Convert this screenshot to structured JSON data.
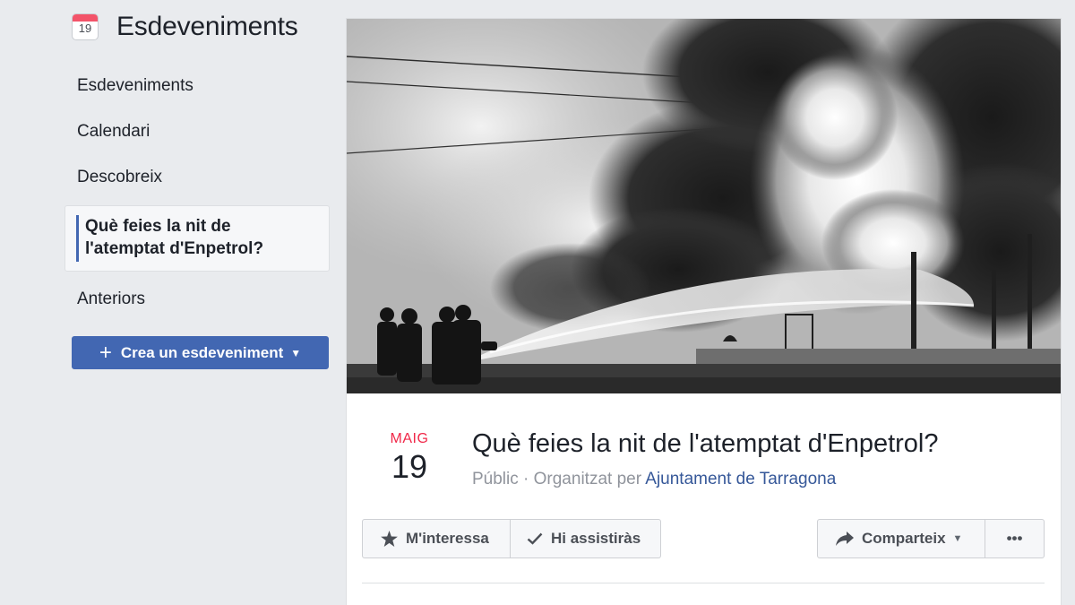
{
  "sidebar": {
    "icon": "calendar-icon",
    "icon_number": "19",
    "title": "Esdeveniments",
    "items": [
      {
        "label": "Esdeveniments"
      },
      {
        "label": "Calendari"
      },
      {
        "label": "Descobreix"
      },
      {
        "label_line1": "Què feies la nit de",
        "label_line2": "l'atemptat d'Enpetrol?"
      },
      {
        "label": "Anteriors"
      }
    ],
    "create_button": "Crea un esdeveniment"
  },
  "event": {
    "month": "MAIG",
    "day": "19",
    "title": "Què feies la nit de l'atemptat d'Enpetrol?",
    "visibility": "Públic",
    "organized_by": "· Organitzat per",
    "organizer": "Ajuntament de Tarragona"
  },
  "actions": {
    "interested": "M'interessa",
    "going": "Hi assistiràs",
    "share": "Comparteix",
    "more": "•••"
  },
  "colors": {
    "accent": "#4267b2",
    "date_month": "#f02849",
    "link": "#365899",
    "background": "#e9ebee"
  }
}
